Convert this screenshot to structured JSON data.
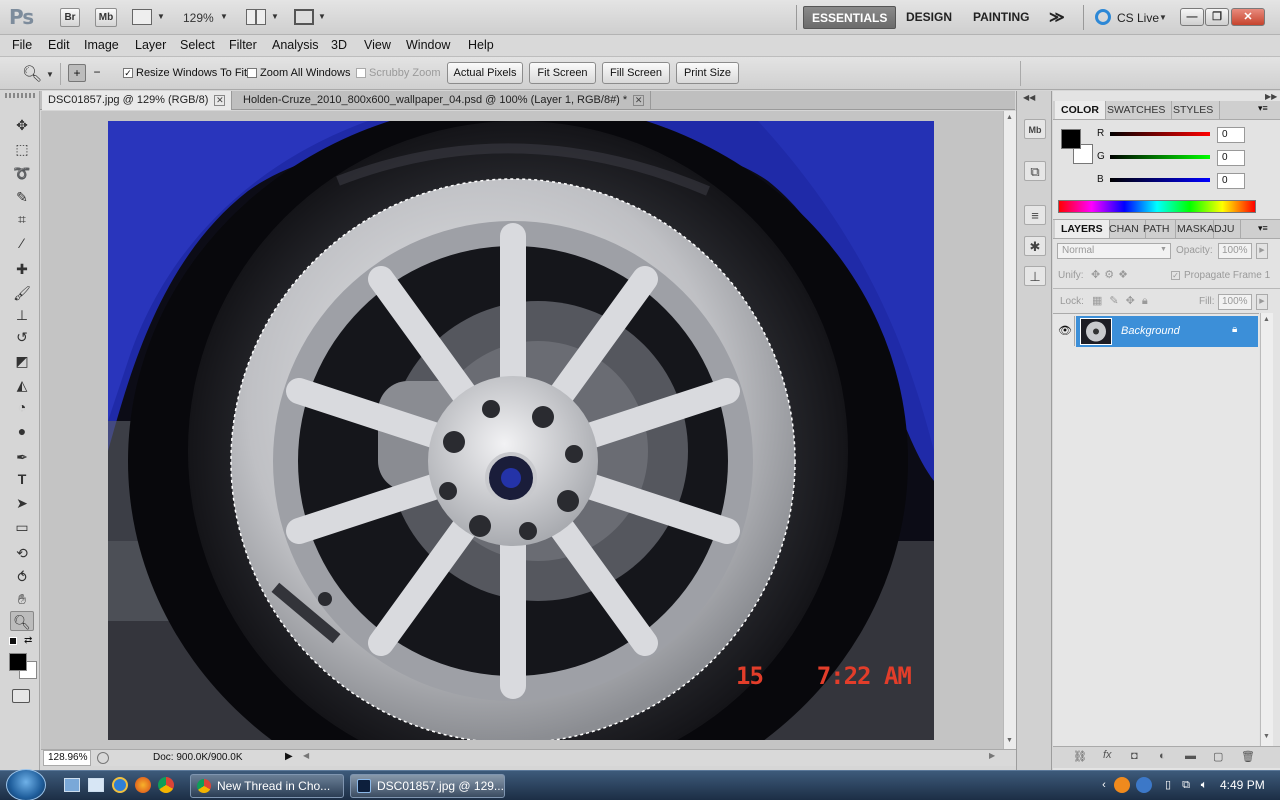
{
  "app": {
    "logo": "Ps",
    "bridge_label": "Br",
    "minibridge_label": "Mb",
    "zoom_level": "129%",
    "workspaces": [
      "ESSENTIALS",
      "DESIGN",
      "PAINTING"
    ],
    "more_workspaces": "≫",
    "cs_live": "CS Live"
  },
  "menu": [
    "File",
    "Edit",
    "Image",
    "Layer",
    "Select",
    "Filter",
    "Analysis",
    "3D",
    "View",
    "Window",
    "Help"
  ],
  "options": {
    "resize_windows": "Resize Windows To Fit",
    "zoom_all_windows": "Zoom All Windows",
    "scrubby_zoom": "Scrubby Zoom",
    "actual_pixels": "Actual Pixels",
    "fit_screen": "Fit Screen",
    "fill_screen": "Fill Screen",
    "print_size": "Print Size"
  },
  "tabs": [
    {
      "label": "DSC01857.jpg @ 129% (RGB/8)"
    },
    {
      "label": "Holden-Cruze_2010_800x600_wallpaper_04.psd @ 100% (Layer 1, RGB/8#) *"
    }
  ],
  "photo": {
    "timestamp": "15    7:22 AM"
  },
  "status": {
    "zoom": "128.96%",
    "doc": "Doc: 900.0K/900.0K"
  },
  "color_panel": {
    "tabs": [
      "COLOR",
      "SWATCHES",
      "STYLES"
    ],
    "r_label": "R",
    "g_label": "G",
    "b_label": "B",
    "r": "0",
    "g": "0",
    "b": "0"
  },
  "layers_panel": {
    "tabs": [
      "LAYERS",
      "CHAN",
      "PATH",
      "MASK",
      "ADJU"
    ],
    "blend_mode": "Normal",
    "opacity_label": "Opacity:",
    "opacity": "100%",
    "unify_label": "Unify:",
    "propagate": "Propagate Frame 1",
    "lock_label": "Lock:",
    "fill_label": "Fill:",
    "fill": "100%",
    "layer_name": "Background"
  },
  "taskbar": {
    "items": [
      "New Thread in Cho...",
      "DSC01857.jpg @ 129..."
    ],
    "clock": "4:49 PM"
  },
  "colors": {
    "accent": "#3c8fd8",
    "close_red": "#c6442e",
    "car_blue": "#1f2aa8"
  }
}
